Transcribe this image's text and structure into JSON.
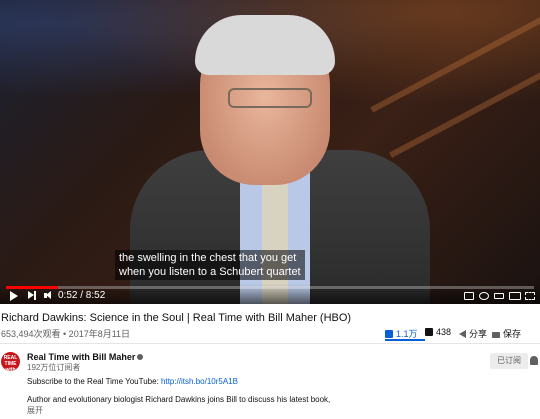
{
  "player": {
    "caption_line1": "the swelling in the chest that you get",
    "caption_line2": "when you listen to a Schubert quartet",
    "current_time": "0:52",
    "duration": "8:52",
    "time_display": "0:52 / 8:52",
    "progress_fraction": 0.098,
    "accent_color": "#ff0000"
  },
  "video": {
    "title": "Richard Dawkins: Science in the Soul | Real Time with Bill Maher (HBO)",
    "views_date": "653,494次观看 • 2017年8月11日",
    "likes": "1.1万",
    "dislikes": "438",
    "share_label": "分享",
    "save_label": "保存"
  },
  "channel": {
    "name": "Real Time with Bill Maher",
    "avatar_text": "REAL TIME with BILL MAHER",
    "subscribers": "192万位订阅者",
    "subscribed_label": "已订阅"
  },
  "description": {
    "line1_prefix": "Subscribe to the Real Time YouTube: ",
    "line1_link": "http://itsh.bo/10r5A1B",
    "line2": "Author and evolutionary biologist Richard Dawkins joins Bill to discuss his latest book,",
    "show_more": "展开"
  }
}
